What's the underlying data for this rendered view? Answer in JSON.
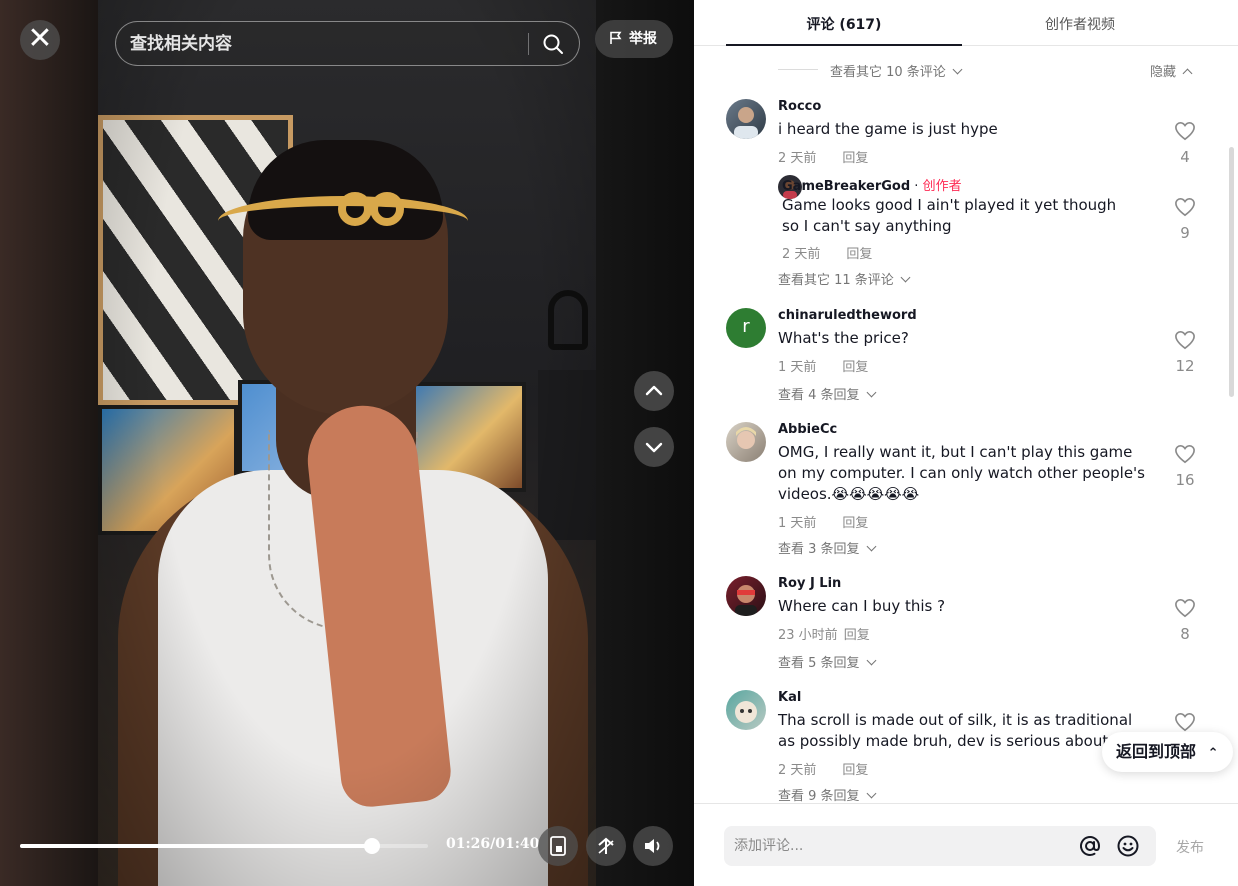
{
  "video": {
    "search_placeholder": "查找相关内容",
    "report_label": "举报",
    "time": "01:26/01:40",
    "progress_fraction": 0.863
  },
  "tabs": [
    {
      "label": "评论 (617)",
      "active": true
    },
    {
      "label": "创作者视频",
      "active": false
    }
  ],
  "thread_top": {
    "view_more": "查看其它 10 条评论",
    "hide": "隐藏"
  },
  "comments": [
    {
      "user": "Rocco",
      "text": "i heard the game is just hype",
      "time": "2 天前",
      "reply": "回复",
      "likes": "4",
      "reply_item": {
        "user": "GameBreakerGod",
        "separator": " · ",
        "creator_tag": "创作者",
        "text": "Game looks good I ain't played it yet though so I can't say anything",
        "time": "2 天前",
        "reply": "回复",
        "likes": "9"
      },
      "more": "查看其它 11 条评论"
    },
    {
      "user": "chinaruledtheword",
      "avatar_letter": "r",
      "text": "What's the price?",
      "time": "1 天前",
      "reply": "回复",
      "likes": "12",
      "more": "查看 4 条回复"
    },
    {
      "user": "AbbieCc",
      "text": "OMG, I really want it, but I can't play this game on my computer. I can only watch other people's videos.😭😭😭😭😭",
      "time": "1 天前",
      "reply": "回复",
      "likes": "16",
      "more": "查看 3 条回复"
    },
    {
      "user": "Roy J Lin",
      "text": "Where can I buy this ?",
      "time": "23 小时前",
      "reply": "回复",
      "likes": "8",
      "more": "查看 5 条回复"
    },
    {
      "user": "Kal",
      "text": "Tha scroll is made out of silk, it is as traditional as possibly made bruh, dev is serious about this",
      "time": "2 天前",
      "reply": "回复",
      "more": "查看 9 条回复"
    }
  ],
  "back_to_top": "返回到顶部",
  "composer": {
    "placeholder": "添加评论...",
    "post_label": "发布"
  },
  "colors": {
    "creator": "#fe2c55",
    "avatar_green": "#2e7d32"
  },
  "icons": [
    "close-icon",
    "search-icon",
    "flag-icon",
    "chevron-up-icon",
    "chevron-down-icon",
    "miniplayer-icon",
    "autoscroll-icon",
    "volume-icon",
    "heart-icon",
    "at-icon",
    "emoji-icon"
  ]
}
